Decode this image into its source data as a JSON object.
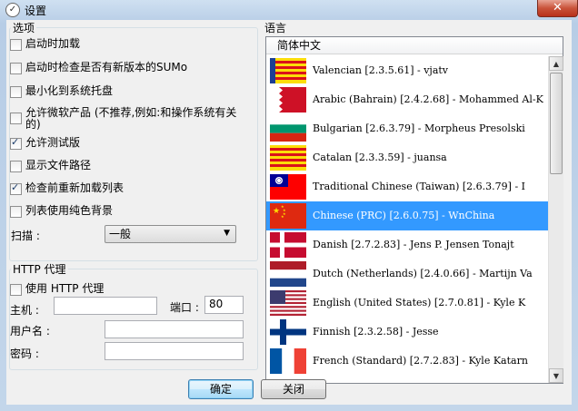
{
  "window": {
    "title": "设置",
    "close_glyph": "✕"
  },
  "options": {
    "legend": "选项",
    "checkboxes": [
      {
        "label": "启动时加载",
        "checked": false
      },
      {
        "label": "启动时检查是否有新版本的SUMo",
        "checked": false
      },
      {
        "label": "最小化到系统托盘",
        "checked": false
      },
      {
        "label": "允许微软产品 (不推荐,例如:和操作系统有关的)",
        "checked": false
      },
      {
        "label": "允许测试版",
        "checked": true
      },
      {
        "label": "显示文件路径",
        "checked": false
      },
      {
        "label": "检查前重新加载列表",
        "checked": true
      },
      {
        "label": "列表使用纯色背景",
        "checked": false
      }
    ],
    "scan_label": "扫描 :",
    "scan_value": "一般"
  },
  "proxy": {
    "legend": "HTTP 代理",
    "use_label": "使用 HTTP 代理",
    "use_checked": false,
    "host_label": "主机 :",
    "host_value": "",
    "port_label": "端口 :",
    "port_value": "80",
    "user_label": "用户名 :",
    "user_value": "",
    "pass_label": "密码 :",
    "pass_value": ""
  },
  "language": {
    "legend": "语言",
    "header": "简体中文",
    "items": [
      {
        "text": "Valencian [2.3.5.61] - vjatv",
        "flag": "valencian",
        "selected": false
      },
      {
        "text": "Arabic (Bahrain) [2.4.2.68] - Mohammed Al-K",
        "flag": "bahrain",
        "selected": false
      },
      {
        "text": "Bulgarian [2.6.3.79] - Morpheus Presolski",
        "flag": "bulgaria",
        "selected": false
      },
      {
        "text": "Catalan [2.3.3.59] - juansa",
        "flag": "catalonia",
        "selected": false
      },
      {
        "text": "Traditional Chinese (Taiwan) [2.6.3.79] - I",
        "flag": "taiwan",
        "selected": false
      },
      {
        "text": "Chinese (PRC) [2.6.0.75] - WnChina",
        "flag": "china",
        "selected": true
      },
      {
        "text": "Danish [2.7.2.83] - Jens P. Jensen Tonajt",
        "flag": "denmark",
        "selected": false
      },
      {
        "text": "Dutch (Netherlands) [2.4.0.66] - Martijn Va",
        "flag": "netherlands",
        "selected": false
      },
      {
        "text": "English (United States) [2.7.0.81] - Kyle K",
        "flag": "usa",
        "selected": false
      },
      {
        "text": "Finnish [2.3.2.58] - Jesse",
        "flag": "finland",
        "selected": false
      },
      {
        "text": "French (Standard) [2.7.2.83] - Kyle Katarn",
        "flag": "france",
        "selected": false
      }
    ]
  },
  "buttons": {
    "ok": "确定",
    "close": "关闭"
  }
}
